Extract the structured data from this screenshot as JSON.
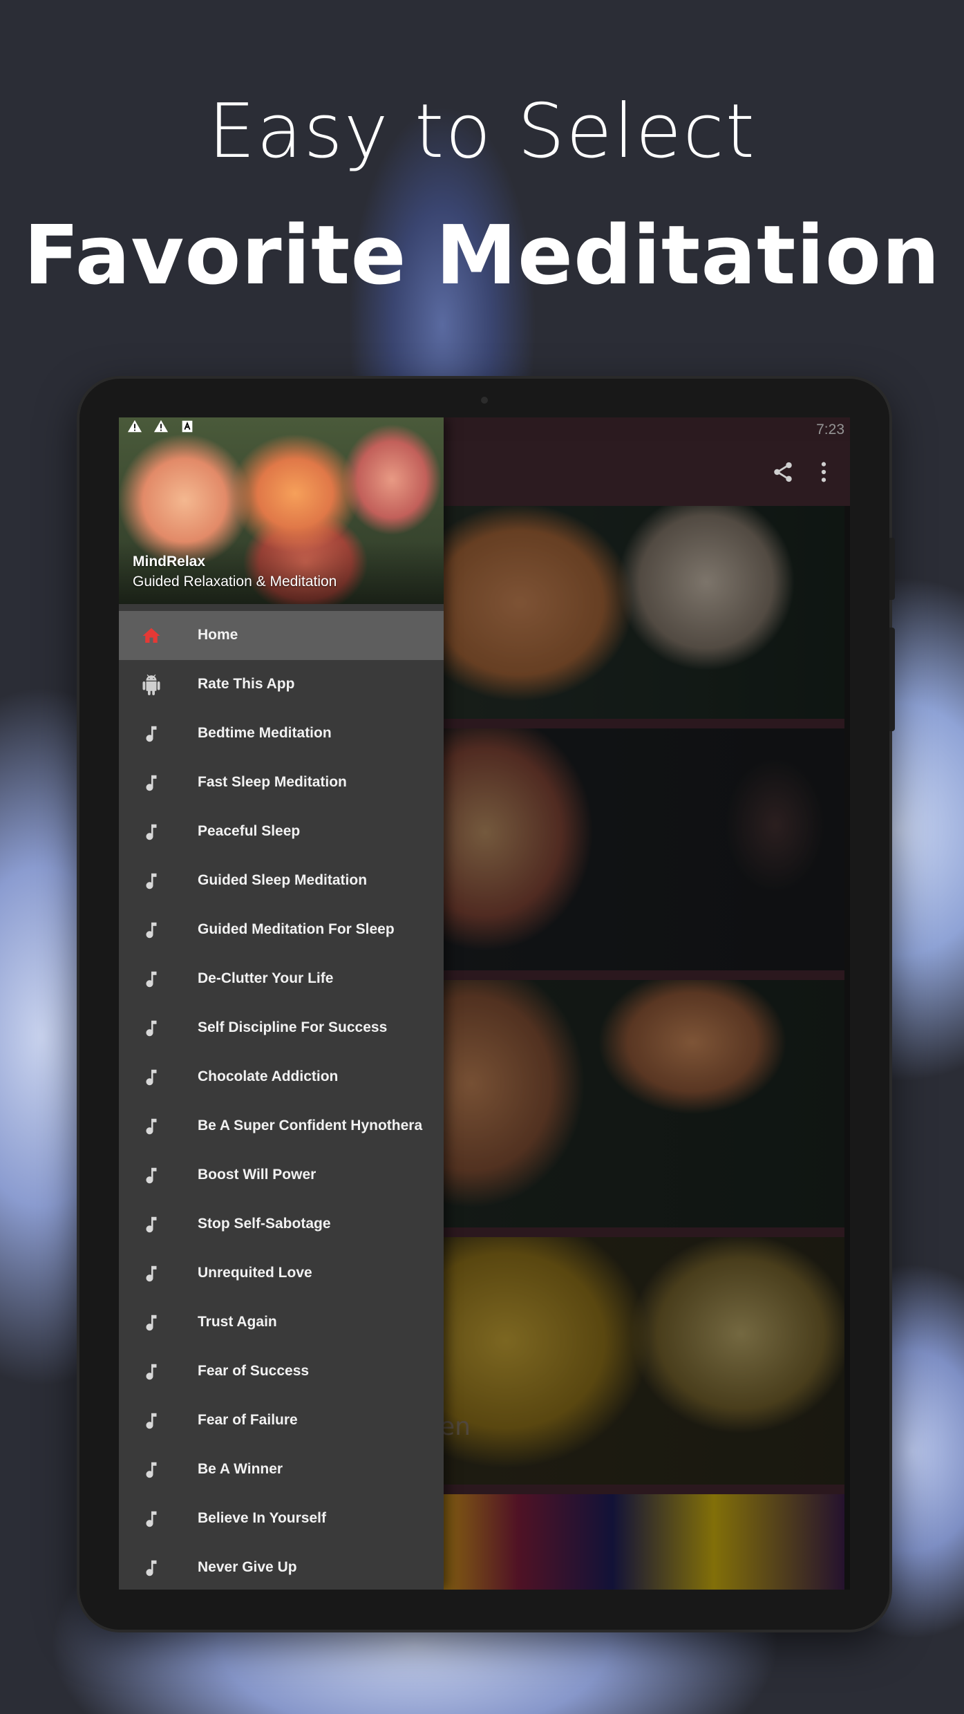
{
  "promo": {
    "line1": "Easy to Select",
    "line2": "Favorite Meditation"
  },
  "status_bar": {
    "time": "7:23"
  },
  "app_bar": {
    "icons": [
      "share-icon",
      "more-vert-icon"
    ]
  },
  "content": {
    "card4_title_fragment": "ren"
  },
  "drawer": {
    "app_name": "MindRelax",
    "app_subtitle": "Guided Relaxation & Meditation",
    "items": [
      {
        "label": "Home",
        "icon": "home-icon",
        "active": true
      },
      {
        "label": "Rate This App",
        "icon": "android-icon"
      },
      {
        "label": "Bedtime Meditation",
        "icon": "music-note-icon"
      },
      {
        "label": "Fast Sleep Meditation",
        "icon": "music-note-icon"
      },
      {
        "label": "Peaceful Sleep",
        "icon": "music-note-icon"
      },
      {
        "label": "Guided Sleep Meditation",
        "icon": "music-note-icon"
      },
      {
        "label": "Guided Meditation For Sleep",
        "icon": "music-note-icon"
      },
      {
        "label": "De-Clutter Your Life",
        "icon": "music-note-icon"
      },
      {
        "label": "Self Discipline For Success",
        "icon": "music-note-icon"
      },
      {
        "label": "Chocolate Addiction",
        "icon": "music-note-icon"
      },
      {
        "label": "Be A Super Confident Hynothera",
        "icon": "music-note-icon"
      },
      {
        "label": "Boost Will Power",
        "icon": "music-note-icon"
      },
      {
        "label": "Stop Self-Sabotage",
        "icon": "music-note-icon"
      },
      {
        "label": "Unrequited Love",
        "icon": "music-note-icon"
      },
      {
        "label": "Trust Again",
        "icon": "music-note-icon"
      },
      {
        "label": "Fear of Success",
        "icon": "music-note-icon"
      },
      {
        "label": "Fear of Failure",
        "icon": "music-note-icon"
      },
      {
        "label": "Be A Winner",
        "icon": "music-note-icon"
      },
      {
        "label": "Believe In Yourself",
        "icon": "music-note-icon"
      },
      {
        "label": "Never Give Up",
        "icon": "music-note-icon"
      }
    ]
  },
  "colors": {
    "background": "#2b2d36",
    "drawer_bg": "#3a3a3a",
    "active_item_bg": "#5e5e5e",
    "home_icon": "#e53935",
    "app_bar": "#4d3038"
  }
}
